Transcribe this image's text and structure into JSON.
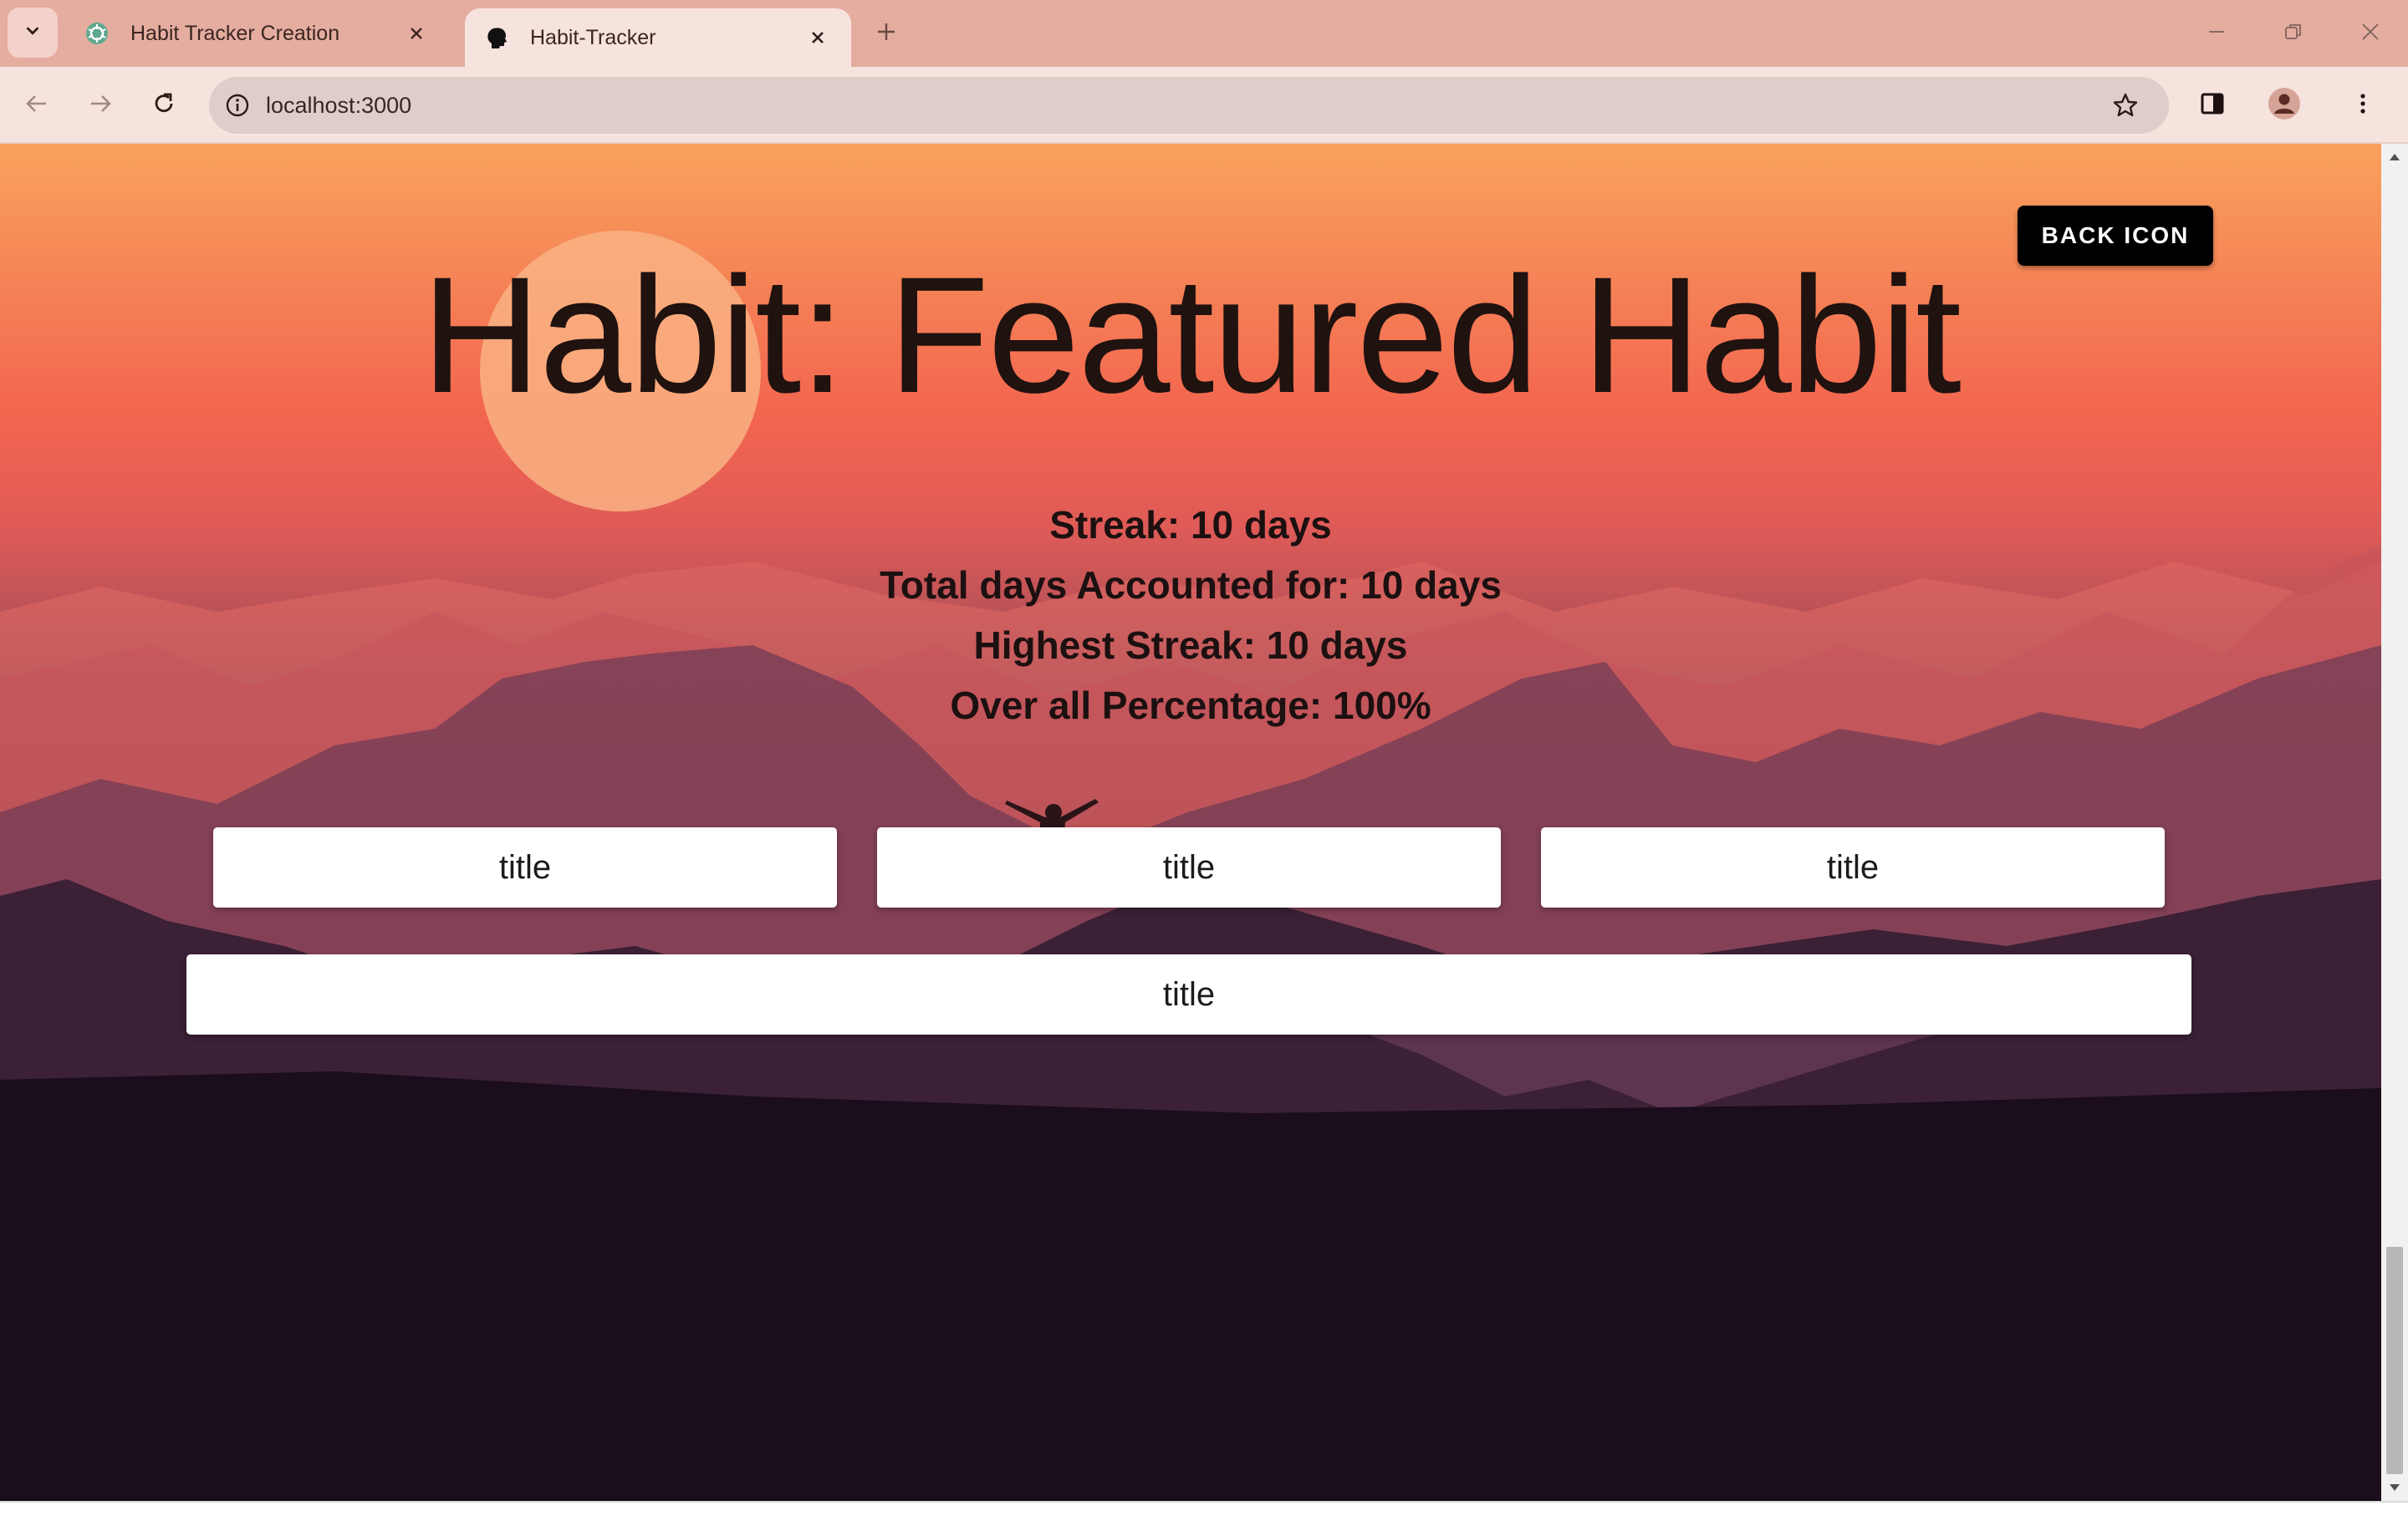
{
  "browser": {
    "tabs": [
      {
        "title": "Habit Tracker Creation",
        "icon": "chatgpt-icon",
        "active": false
      },
      {
        "title": "Habit-Tracker",
        "icon": "head-silhouette-icon",
        "active": true
      }
    ],
    "address_bar": {
      "url": "localhost:3000"
    },
    "colors": {
      "tab_strip": "#e4ada0",
      "toolbar": "#f7e3de",
      "omnibox": "#decdc9"
    }
  },
  "page": {
    "back_button_label": "BACK ICON",
    "title": "Habit: Featured Habit",
    "stats": {
      "streak": "Streak: 10 days",
      "total_days": "Total days Accounted for: 10 days",
      "highest_streak": "Highest Streak: 10 days",
      "overall_percentage": "Over all Percentage: 100%"
    },
    "cards": [
      {
        "label": "title"
      },
      {
        "label": "title"
      },
      {
        "label": "title"
      },
      {
        "label": "title"
      }
    ],
    "colors": {
      "title_text": "#1f120f",
      "button_bg": "#000000",
      "card_bg": "#ffffff",
      "sky_top": "#f9a25c",
      "ground": "#1a0d1c"
    }
  }
}
